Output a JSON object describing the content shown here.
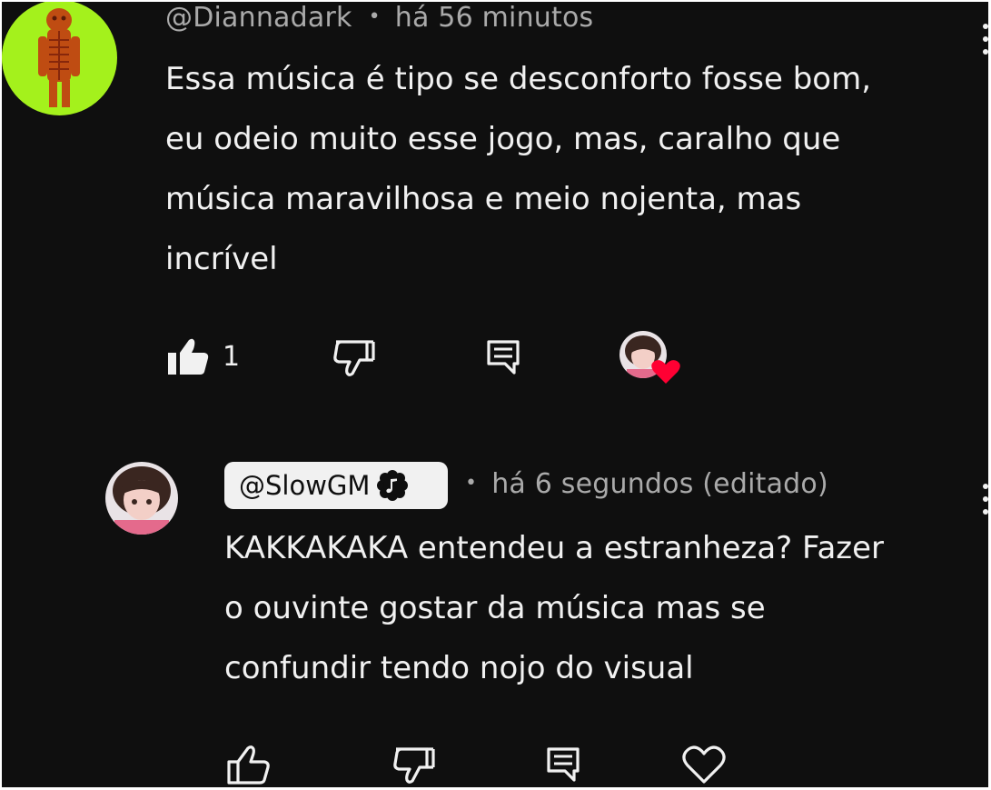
{
  "comment": {
    "author": "@Diannadark",
    "separator": "•",
    "time": "há 56 minutos",
    "text_lines": [
      "Essa música é tipo se desconforto fosse bom,",
      "eu odeio muito esse jogo, mas, caralho que",
      "música maravilhosa e meio nojenta, mas",
      "incrível"
    ],
    "like_count": "1",
    "liked": true,
    "hearted_by_creator": true
  },
  "reply": {
    "author": "@SlowGM",
    "author_badge_icon": "music-note-badge-icon",
    "separator": "•",
    "time": "há 6 segundos (editado)",
    "text_lines": [
      "KAKKAKAKA entendeu a estranheza? Fazer",
      "o ouvinte gostar da música mas se",
      "confundir tendo nojo do visual"
    ],
    "liked": false
  },
  "colors": {
    "background": "#0f0f0f",
    "text_primary": "#f1f1f1",
    "text_secondary": "#aaaaaa",
    "heart": "#ff0033",
    "avatar_green": "#a4f11c"
  },
  "icons": {
    "like": "thumbs-up-icon",
    "dislike": "thumbs-down-icon",
    "reply": "reply-comment-icon",
    "heart": "heart-icon",
    "more": "more-vertical-icon"
  }
}
